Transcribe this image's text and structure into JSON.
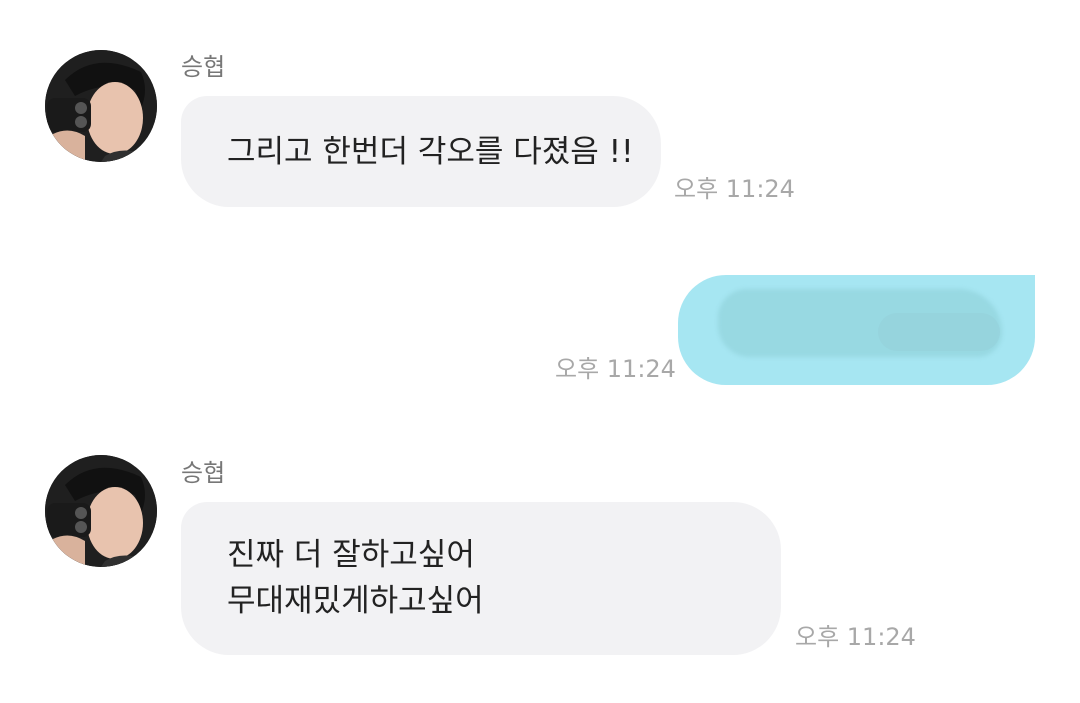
{
  "messages": [
    {
      "sender": "승협",
      "direction": "received",
      "lines": [
        "그리고 한번더 각오를 다졌음 !!"
      ],
      "time": "오후 11:24"
    },
    {
      "direction": "sent",
      "content_state": "censored",
      "time": "오후 11:24"
    },
    {
      "sender": "승협",
      "direction": "received",
      "lines": [
        "진짜 더 잘하고싶어",
        "무대재밌게하고싶어"
      ],
      "time": "오후 11:24"
    }
  ],
  "colors": {
    "received_bubble": "#f2f2f4",
    "sent_bubble": "#a6e6f2",
    "time_text": "#a8a8a8",
    "sender_text": "#777777"
  },
  "icons": {
    "avatar": "profile-photo-icon"
  }
}
